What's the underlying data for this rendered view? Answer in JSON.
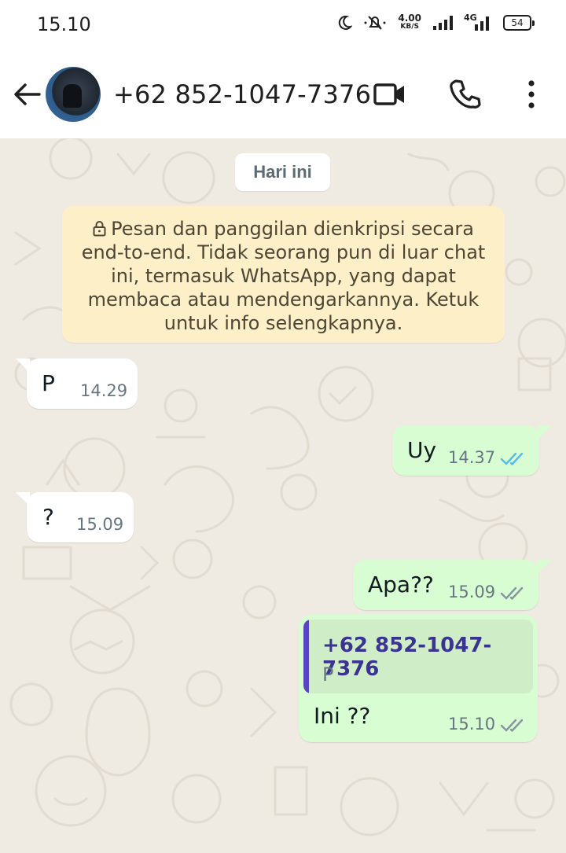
{
  "status_bar": {
    "time": "15.10",
    "net_speed_value": "4.00",
    "net_speed_unit": "KB/S",
    "network_type": "4G",
    "battery": "54"
  },
  "header": {
    "contact_name": "+62 852-1047-7376",
    "icons": [
      "back-arrow-icon",
      "avatar",
      "video-call-icon",
      "voice-call-icon",
      "more-options-icon"
    ]
  },
  "chat": {
    "date_label": "Hari ini",
    "encryption_notice": "Pesan dan panggilan dienkripsi secara end-to-end. Tidak seorang pun di luar chat ini, termasuk WhatsApp, yang dapat membaca atau mendengarkannya. Ketuk untuk info selengkapnya.",
    "messages": [
      {
        "direction": "incoming",
        "text": "P",
        "time": "14.29"
      },
      {
        "direction": "outgoing",
        "text": "Uy",
        "time": "14.37",
        "status": "read"
      },
      {
        "direction": "incoming",
        "text": "?",
        "time": "15.09"
      },
      {
        "direction": "outgoing",
        "text": "Apa??",
        "time": "15.09",
        "status": "delivered"
      },
      {
        "direction": "outgoing",
        "text": "Ini ??",
        "time": "15.10",
        "status": "delivered",
        "reply_to": {
          "name": "+62 852-1047-7376",
          "text": "P"
        }
      }
    ]
  },
  "colors": {
    "chat_background": "#efeae2",
    "incoming_bubble": "#ffffff",
    "outgoing_bubble": "#d9fdd3",
    "read_ticks": "#53bdeb",
    "delivered_ticks": "#8696a0",
    "encryption_notice_bg": "#fdf0c8",
    "reply_accent": "#5a44c4"
  }
}
